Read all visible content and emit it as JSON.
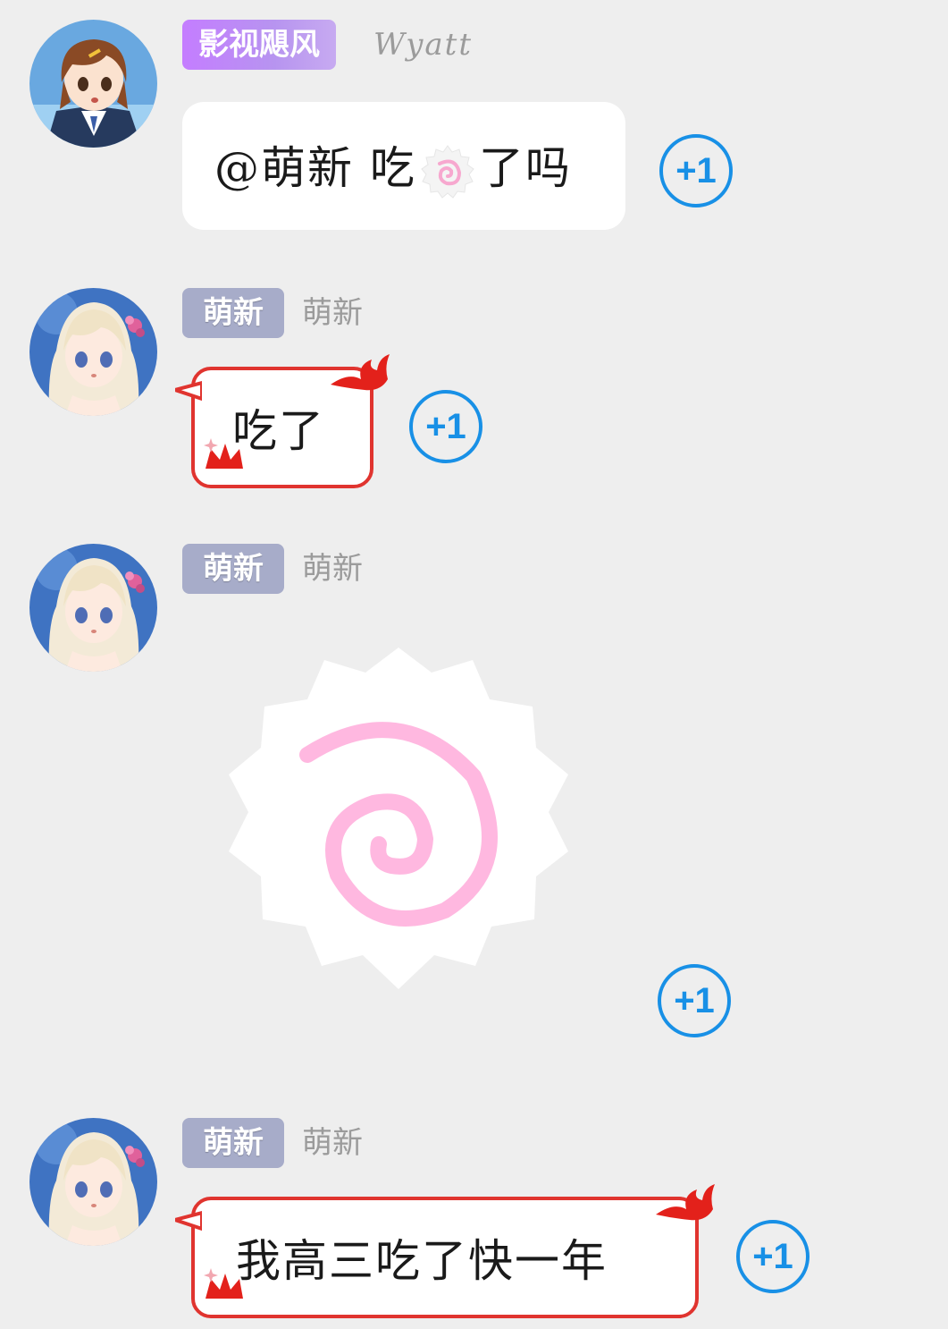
{
  "messages": [
    {
      "title_badge": "影视飓风",
      "nickname": "Wyatt",
      "text_parts": [
        "@萌新 吃",
        "了吗"
      ],
      "inline_emoji": "narutomaki-icon",
      "plus_one": "+1"
    },
    {
      "title_badge": "萌新",
      "nickname": "萌新",
      "text": "吃了",
      "plus_one": "+1"
    },
    {
      "title_badge": "萌新",
      "nickname": "萌新",
      "sticker": "narutomaki-sticker",
      "plus_one": "+1"
    },
    {
      "title_badge": "萌新",
      "nickname": "萌新",
      "text": "我高三吃了快一年",
      "plus_one": "+1"
    }
  ],
  "colors": {
    "background": "#eeeeee",
    "badge_purple": "#c47dff",
    "badge_slate": "#a7acc9",
    "bubble_border_red": "#e0342f",
    "plus_one_blue": "#1890e6",
    "spiral_pink": "#ffb8e0"
  }
}
